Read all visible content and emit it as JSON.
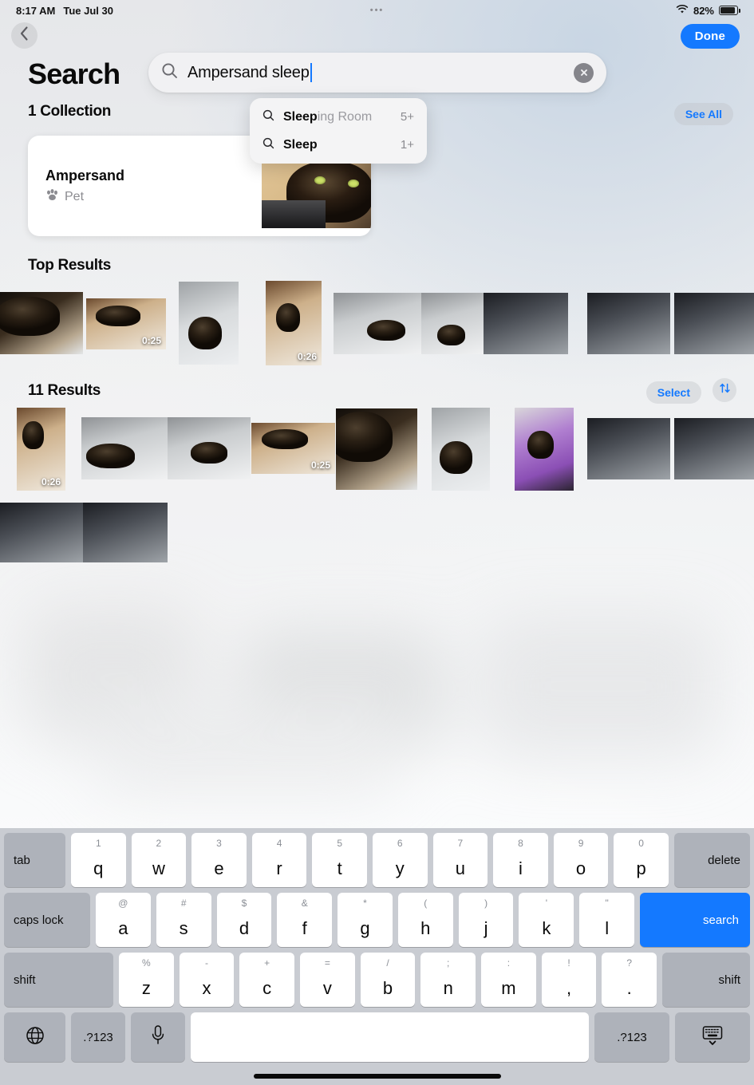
{
  "status_bar": {
    "time": "8:17 AM",
    "date": "Tue Jul 30",
    "center_dots": "•••",
    "battery_percent": "82%",
    "wifi_icon": "wifi-icon",
    "battery_icon": "battery-icon"
  },
  "nav": {
    "back_icon": "chevron-left-icon",
    "done_label": "Done"
  },
  "header": {
    "title": "Search"
  },
  "search": {
    "icon": "magnifier-icon",
    "value": "Ampersand sleep",
    "placeholder": "Search",
    "clear_icon": "clear-circle-icon"
  },
  "suggestions": [
    {
      "icon": "magnifier-icon",
      "match": "Sleep",
      "rest": "ing Room",
      "count": "5+"
    },
    {
      "icon": "magnifier-icon",
      "match": "Sleep",
      "rest": "",
      "count": "1+"
    }
  ],
  "collections_section": {
    "title": "1 Collection",
    "see_all_label": "See All",
    "card": {
      "name": "Ampersand",
      "category": "Pet",
      "category_icon": "paw-icon"
    }
  },
  "top_results_section": {
    "title": "Top Results",
    "items": [
      {
        "duration": ""
      },
      {
        "duration": "0:25"
      },
      {
        "duration": ""
      },
      {
        "duration": "0:26"
      },
      {
        "duration": ""
      },
      {
        "duration": ""
      },
      {
        "duration": ""
      },
      {
        "duration": ""
      },
      {
        "duration": ""
      }
    ]
  },
  "results_section": {
    "title": "11 Results",
    "select_label": "Select",
    "sort_icon": "sort-arrows-icon",
    "items": [
      {
        "duration": "0:26"
      },
      {
        "duration": ""
      },
      {
        "duration": ""
      },
      {
        "duration": "0:25"
      },
      {
        "duration": ""
      },
      {
        "duration": ""
      },
      {
        "duration": ""
      },
      {
        "duration": ""
      },
      {
        "duration": ""
      },
      {
        "duration": ""
      },
      {
        "duration": ""
      }
    ]
  },
  "keyboard": {
    "row1": [
      {
        "label": "tab",
        "type": "mod"
      },
      {
        "label": "q",
        "alt": "1"
      },
      {
        "label": "w",
        "alt": "2"
      },
      {
        "label": "e",
        "alt": "3"
      },
      {
        "label": "r",
        "alt": "4"
      },
      {
        "label": "t",
        "alt": "5"
      },
      {
        "label": "y",
        "alt": "6"
      },
      {
        "label": "u",
        "alt": "7"
      },
      {
        "label": "i",
        "alt": "8"
      },
      {
        "label": "o",
        "alt": "9"
      },
      {
        "label": "p",
        "alt": "0"
      },
      {
        "label": "delete",
        "type": "mod"
      }
    ],
    "row2": [
      {
        "label": "caps lock",
        "type": "mod"
      },
      {
        "label": "a",
        "alt": "@"
      },
      {
        "label": "s",
        "alt": "#"
      },
      {
        "label": "d",
        "alt": "$"
      },
      {
        "label": "f",
        "alt": "&"
      },
      {
        "label": "g",
        "alt": "*"
      },
      {
        "label": "h",
        "alt": "("
      },
      {
        "label": "j",
        "alt": ")"
      },
      {
        "label": "k",
        "alt": "'"
      },
      {
        "label": "l",
        "alt": "\""
      },
      {
        "label": "search",
        "type": "go"
      }
    ],
    "row3": [
      {
        "label": "shift",
        "type": "mod"
      },
      {
        "label": "z",
        "alt": "%"
      },
      {
        "label": "x",
        "alt": "-"
      },
      {
        "label": "c",
        "alt": "+"
      },
      {
        "label": "v",
        "alt": "="
      },
      {
        "label": "b",
        "alt": "/"
      },
      {
        "label": "n",
        "alt": ";"
      },
      {
        "label": "m",
        "alt": ":"
      },
      {
        "label": ",",
        "alt": "!"
      },
      {
        "label": ".",
        "alt": "?"
      },
      {
        "label": "shift",
        "type": "mod"
      }
    ],
    "row4": [
      {
        "label": "",
        "icon": "globe-icon",
        "type": "mod"
      },
      {
        "label": ".?123",
        "type": "mod"
      },
      {
        "label": "",
        "icon": "microphone-icon",
        "type": "mod"
      },
      {
        "label": "",
        "type": "space"
      },
      {
        "label": ".?123",
        "type": "mod"
      },
      {
        "label": "",
        "icon": "dismiss-keyboard-icon",
        "type": "mod"
      }
    ]
  },
  "colors": {
    "accent_blue": "#1479ff",
    "keyboard_bg": "#c9ccd2",
    "key_mod": "#aeb2ba",
    "text_primary": "#0a0a0a",
    "text_secondary": "#8b8b90"
  }
}
